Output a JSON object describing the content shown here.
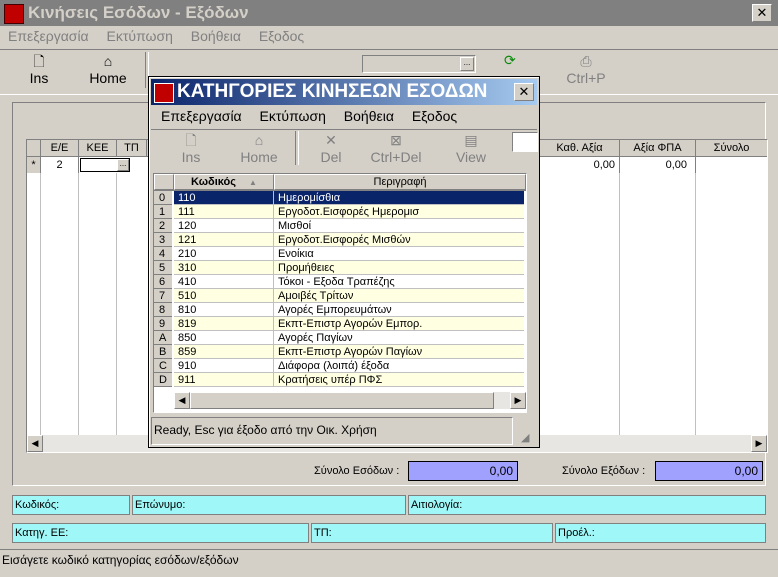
{
  "main_window": {
    "title": "Κινήσεις Εσόδων - Εξόδων",
    "close_glyph": "✕",
    "menu": [
      "Επεξεργασία",
      "Εκτύπωση",
      "Βοήθεια",
      "Εξοδος"
    ],
    "toolbar": {
      "ins": "Ins",
      "home": "Home",
      "ctrlp": "Ctrl+P",
      "combo_arrow": "..."
    },
    "grid": {
      "headers": [
        "Ε/Ε",
        "ΚΕΕ",
        "ΤΠ"
      ],
      "right_headers": [
        "Καθ. Αξία",
        "Αξία ΦΠΑ",
        "Σύνολο"
      ],
      "row": {
        "marker": "*",
        "ee": "2",
        "kath_axia": "0,00",
        "axia_fpa": "0,00"
      }
    },
    "totals": {
      "income_label": "Σύνολο Εσόδων :",
      "income_value": "0,00",
      "expense_label": "Σύνολο Εξόδων :",
      "expense_value": "0,00"
    },
    "fields": {
      "kodikos": "Κωδικός:",
      "eponymo": "Επώνυμο:",
      "aitiologia": "Αιτιολογία:",
      "katig": "Κατηγ. ΕΕ:",
      "tp": "ΤΠ:",
      "proel": "Προέλ.:"
    },
    "status": "Εισάγετε κωδικό κατηγορίας εσόδων/εξόδων"
  },
  "dialog": {
    "title": "ΚΑΤΗΓΟΡΙΕΣ ΚΙΝΗΣΕΩΝ ΕΣΟΔΩΝ",
    "close_glyph": "✕",
    "menu": [
      "Επεξεργασία",
      "Εκτύπωση",
      "Βοήθεια",
      "Εξοδος"
    ],
    "toolbar": [
      "Ins",
      "Home",
      "Del",
      "Ctrl+Del",
      "View"
    ],
    "columns": {
      "code": "Κωδικός",
      "desc": "Περιγραφή"
    },
    "rows": [
      {
        "idx": "0",
        "code": "110",
        "desc": "Ημερομίσθια"
      },
      {
        "idx": "1",
        "code": "111",
        "desc": "Εργοδοτ.Εισφορές Ημερομισ"
      },
      {
        "idx": "2",
        "code": "120",
        "desc": "Μισθοί"
      },
      {
        "idx": "3",
        "code": "121",
        "desc": "Εργοδοτ.Εισφορές Μισθών"
      },
      {
        "idx": "4",
        "code": "210",
        "desc": "Ενοίκια"
      },
      {
        "idx": "5",
        "code": "310",
        "desc": "Προμήθειες"
      },
      {
        "idx": "6",
        "code": "410",
        "desc": "Τόκοι - Εξοδα Τραπέζης"
      },
      {
        "idx": "7",
        "code": "510",
        "desc": "Αμοιβές Τρίτων"
      },
      {
        "idx": "8",
        "code": "810",
        "desc": "Αγορές Εμπορευμάτων"
      },
      {
        "idx": "9",
        "code": "819",
        "desc": "Εκπτ-Επιστρ Αγορών Εμπορ."
      },
      {
        "idx": "A",
        "code": "850",
        "desc": "Αγορές Παγίων"
      },
      {
        "idx": "B",
        "code": "859",
        "desc": "Εκπτ-Επιστρ Αγορών Παγίων"
      },
      {
        "idx": "C",
        "code": "910",
        "desc": "Διάφορα (λοιπά) έξοδα"
      },
      {
        "idx": "D",
        "code": "911",
        "desc": "Κρατήσεις υπέρ ΠΦΣ"
      }
    ],
    "status": "Ready, Esc για έξοδο από την Οικ. Χρήση"
  },
  "colors": {
    "selected": "#0a246a",
    "row_alt": "#ffffe1",
    "cyan": "#9ff7f7",
    "lavender": "#a0a0ff"
  }
}
